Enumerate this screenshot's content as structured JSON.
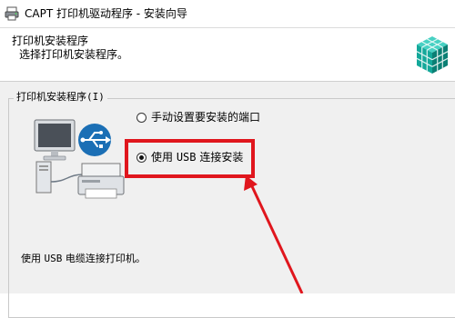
{
  "window": {
    "title": "CAPT 打印机驱动程序 - 安装向导",
    "app_icon": "printer-app-icon"
  },
  "header": {
    "title": "打印机安装程序",
    "subtitle": "选择打印机安装程序。",
    "logo_icon": "canon-cube-logo"
  },
  "group": {
    "label": "打印机安装程序(I)",
    "options": [
      {
        "label": "手动设置要安装的端口",
        "selected": false
      },
      {
        "label_prefix": "使用 ",
        "label_mono": "USB",
        "label_suffix": " 连接安装",
        "selected": true
      }
    ],
    "illustration_icon": "computer-usb-printer-illustration",
    "description_prefix": "使用 ",
    "description_mono": "USB",
    "description_suffix": " 电缆连接打印机。"
  },
  "annotation": {
    "highlight_color": "#e0161d",
    "arrow_color": "#e0161d"
  }
}
